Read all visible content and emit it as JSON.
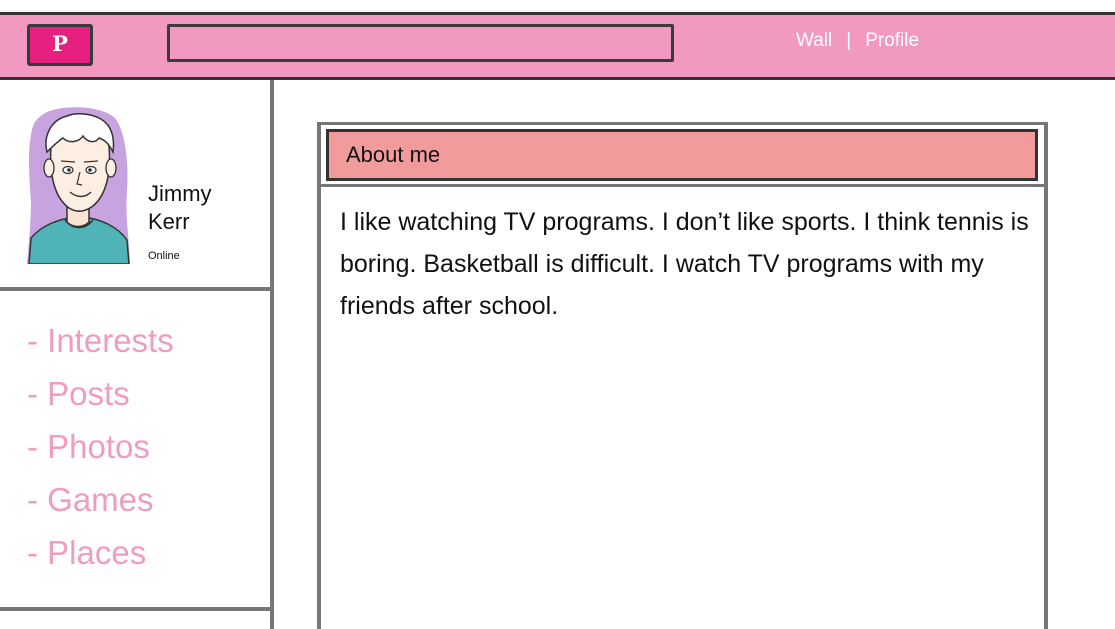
{
  "header": {
    "logo_text": "P",
    "search": {
      "value": "",
      "placeholder": ""
    },
    "nav": {
      "wall_label": "Wall",
      "separator": "|",
      "profile_label": "Profile"
    },
    "colors": {
      "bar": "#f299c1",
      "logo": "#e5207f"
    }
  },
  "profile": {
    "first_name": "Jimmy",
    "last_name": "Kerr",
    "status": "Online",
    "avatar_icon": "boy-avatar-illustration"
  },
  "sidebar": {
    "items": [
      {
        "label": "- Interests"
      },
      {
        "label": "- Posts"
      },
      {
        "label": "- Photos"
      },
      {
        "label": "- Games"
      },
      {
        "label": "- Places"
      }
    ],
    "item_color": "#ef9cc2"
  },
  "about": {
    "title": "About me",
    "body": "I like watching TV programs. I don’t like sports. I think tennis is boring. Basketball is difficult. I watch TV programs with my friends after school.",
    "header_color": "#f29b9d"
  }
}
